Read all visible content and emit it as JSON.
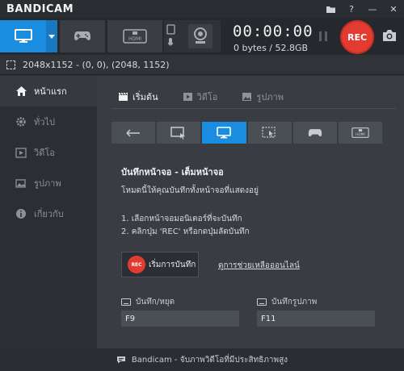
{
  "app": {
    "title": "BANDICAM"
  },
  "titlebar": {
    "icons": [
      "folder-icon",
      "help-icon",
      "minimize-icon",
      "close-icon"
    ],
    "folder_glyph": "▆",
    "help_glyph": "?",
    "minimize_glyph": "—",
    "close_glyph": "✕"
  },
  "toolbar": {
    "modes": [
      "screen-mode",
      "game-mode",
      "hdmi-mode",
      "webcam-mode"
    ],
    "hdmi_label": "HDMI",
    "timer": "00:00:00",
    "size": "0 bytes / 52.8GB",
    "rec_label": "REC"
  },
  "region": {
    "text": "2048x1152 - (0, 0), (2048, 1152)"
  },
  "sidebar": {
    "items": [
      {
        "label": "หน้าแรก",
        "icon": "home-icon",
        "active": true
      },
      {
        "label": "ทั่วไป",
        "icon": "gear-icon",
        "active": false
      },
      {
        "label": "วิดีโอ",
        "icon": "video-icon",
        "active": false
      },
      {
        "label": "รูปภาพ",
        "icon": "image-icon",
        "active": false
      },
      {
        "label": "เกี่ยวกับ",
        "icon": "info-icon",
        "active": false
      }
    ]
  },
  "main": {
    "tabs": [
      {
        "label": "เริ่มต้น",
        "icon": "clapper-icon",
        "active": true
      },
      {
        "label": "วิดีโอ",
        "icon": "play-icon",
        "active": false
      },
      {
        "label": "รูปภาพ",
        "icon": "picture-icon",
        "active": false
      }
    ],
    "mode_buttons": [
      "back-arrow",
      "rectangle-mode",
      "fullscreen-mode",
      "around-mouse-mode",
      "game-mode",
      "hdmi-mode"
    ],
    "title": "บันทึกหน้าจอ - เต็มหน้าจอ",
    "description": "โหมดนี้ให้คุณบันทึกทั้งหน้าจอที่แสดงอยู่",
    "steps": [
      "1. เลือกหน้าจอมอนิเตอร์ที่จะบันทึก",
      "2. คลิกปุ่ม 'REC' หรือกดปุ่มลัดบันทึก"
    ],
    "start_button": {
      "badge": "REC",
      "label": "เริ่มการบันทึก"
    },
    "help_link": "ดูการช่วยเหลือออนไลน์",
    "hotkeys": [
      {
        "label": "บันทึก/หยุด",
        "value": "F9"
      },
      {
        "label": "บันทึกรูปภาพ",
        "value": "F11"
      }
    ]
  },
  "status": {
    "text": "Bandicam - จับภาพวิดีโอที่มีประสิทธิภาพสูง"
  },
  "colors": {
    "accent": "#1a8de0",
    "rec": "#e23b30",
    "background": "#2b2e33",
    "panel": "#393c42"
  }
}
